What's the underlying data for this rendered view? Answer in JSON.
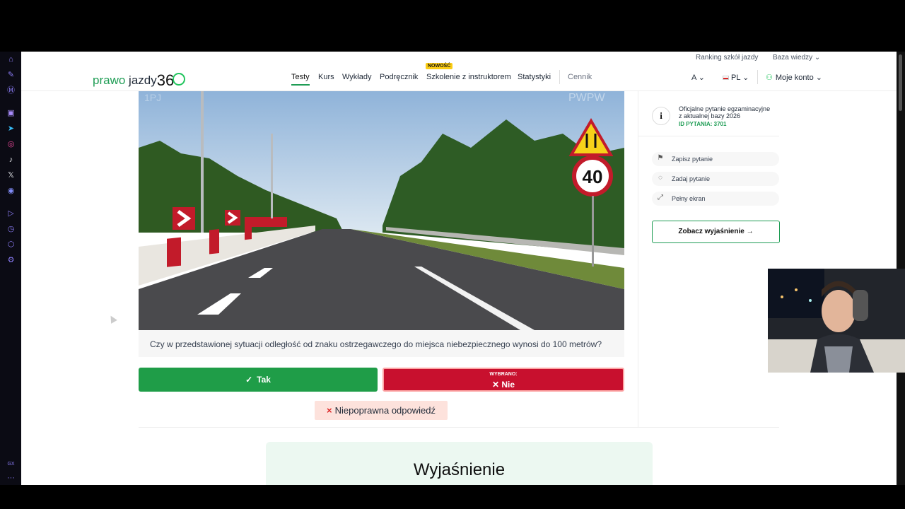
{
  "header": {
    "logo": {
      "part1": "prawo",
      "part2": "jazdy",
      "part3": "36"
    },
    "top_links": [
      "Ranking szkół jazdy",
      "Baza wiedzy ⌄"
    ],
    "nav": [
      "Testy",
      "Kurs",
      "Wykłady",
      "Podręcznik",
      "Szkolenie z instruktorem",
      "Statystyki",
      "Cennik"
    ],
    "new_badge": "NOWOŚĆ",
    "font_size_label": "A ⌄",
    "language": "PL ⌄",
    "account": "Moje konto ⌄"
  },
  "question": {
    "text": "Czy w przedstawionej sytuacji odległość od znaku ostrzegawczego do miejsca niebezpiecznego wynosi do 100 metrów?",
    "watermark_left": "1PJ",
    "watermark_right": "PWPW",
    "sign_speed": "40"
  },
  "answers": {
    "yes_label": "Tak",
    "no_label": "Nie",
    "chosen_label": "WYBRANO:"
  },
  "result": {
    "icon": "×",
    "text": "Niepoprawna odpowiedź"
  },
  "sidebar": {
    "info_line1": "Oficjalne pytanie egzaminacyjne",
    "info_line2": "z aktualnej bazy 2026",
    "info_id": "ID PYTANIA: 3701",
    "actions": [
      "Zapisz pytanie",
      "Zadaj pytanie",
      "Pełny ekran"
    ],
    "explain_button": "Zobacz wyjaśnienie →"
  },
  "explanation": {
    "title": "Wyjaśnienie"
  },
  "browser_sidebar": {
    "bottom_label": "GX",
    "more": "···"
  },
  "colors": {
    "brand_green": "#1f9d55",
    "yes_green": "#1f9d48",
    "no_red": "#c8102e",
    "result_bg": "#fde2dc",
    "expl_bg": "#ecf8f1"
  }
}
